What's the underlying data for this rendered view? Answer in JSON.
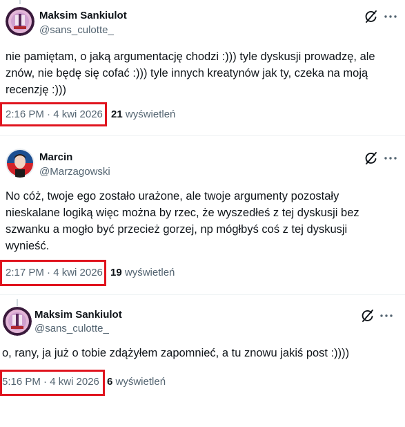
{
  "tweets": [
    {
      "author": "Maksim Sankiulot",
      "handle": "@sans_culotte_",
      "text": "nie pamiętam, o jaką argumentację chodzi :))) tyle dyskusji prowadzę, ale znów, nie będę się cofać :))) tyle innych kreatynów jak ty, czeka na moją recenzję :)))",
      "timestamp": "2:16 PM · 4 kwi 2026",
      "views_count": "21",
      "views_label": "wyświetleń"
    },
    {
      "author": "Marcin",
      "handle": "@Marzagowski",
      "text": "No cóż, twoje ego zostało urażone, ale twoje argumenty pozostały nieskalane logiką więc można by rzec, że wyszedłeś z tej dyskusji bez szwanku a mogło być przecież gorzej, np mógłbyś coś z tej dyskusji wynieść.",
      "timestamp": "2:17 PM · 4 kwi 2026",
      "views_count": "19",
      "views_label": "wyświetleń"
    },
    {
      "author": "Maksim Sankiulot",
      "handle": "@sans_culotte_",
      "text": "o, rany, ja już o tobie zdążyłem zapomnieć, a tu znowu jakiś post :))))",
      "timestamp": "5:16 PM · 4 kwi 2026",
      "views_count": "6",
      "views_label": "wyświetleń"
    }
  ],
  "colors": {
    "highlight": "#e0141e",
    "secondary_text": "#536471",
    "primary_text": "#0f1419"
  },
  "icons": [
    "grok-icon",
    "more-options-icon"
  ]
}
